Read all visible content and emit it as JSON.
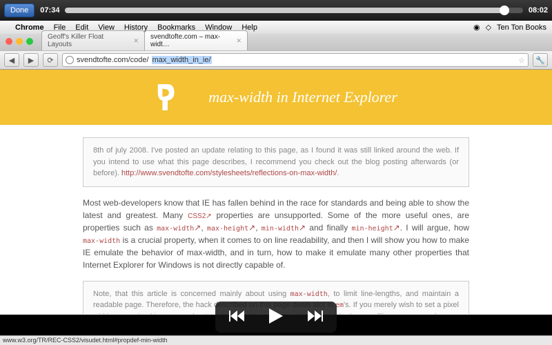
{
  "player": {
    "done_label": "Done",
    "elapsed": "07:34",
    "total": "08:02",
    "status_url": "www.w3.org/TR/REC-CSS2/visudet.html#propdef-min-width"
  },
  "mac_menu": {
    "app": "Chrome",
    "items": [
      "File",
      "Edit",
      "View",
      "History",
      "Bookmarks",
      "Window",
      "Help"
    ],
    "right_text": "Ten Ton Books"
  },
  "browser": {
    "tabs": [
      {
        "title": "Geoff's Killer Float Layouts"
      },
      {
        "title": "svendtofte.com – max-widt…"
      }
    ],
    "url_prefix": "svendtofte.com/code/",
    "url_selected": "max_width_in_ie/",
    "active_tab": 1
  },
  "page": {
    "hero_title": "max-width in Internet Explorer",
    "notice_text_a": "8th of july 2008. I've posted an update relating to this page, as I found it was still linked around the web. If you intend to use what this page describes, I recommend you check out the blog posting afterwards (or before). ",
    "notice_link": "http://www.svendtofte.com/stylesheets/reflections-on-max-width/",
    "p1_a": "Most web-developers know that IE has fallen behind in the race for standards and being able to show the latest and greatest. Many ",
    "p1_css2": "CSS2",
    "p1_b": " properties are unsupported. Some of the more useful ones, are properties such as ",
    "code_maxw": "max-width",
    "code_maxh": "max-height",
    "code_minw": "min-width",
    "code_minh": "min-height",
    "p1_c": " and finally ",
    "p1_d": ". I will argue, how ",
    "p1_e": " is a crucial property, when it comes to on line readability, and then I will show you how to make IE emulate the behavior of max-width, and in turn, how to make it emulate many other properties that Internet Explorer for Windows is not directly capable of.",
    "notice2_a": "Note, that this article is concerned mainly about using ",
    "notice2_b": ", to limit line-lengths, and maintain a readable page. Therefore, the hack described on this page deals alot in ",
    "code_em": "em",
    "notice2_c": "'s. If you merely wish to set a pixel width constraint, it's even easier, I've described how this can be done at the bottom. There, you can also see how this trick can easily be used to emulate any of the other max/min/width/height combinations."
  }
}
